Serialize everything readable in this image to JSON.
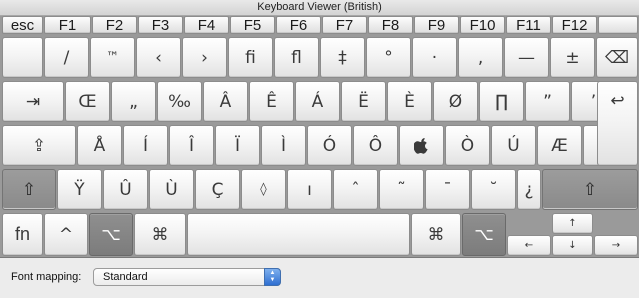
{
  "window": {
    "title": "Keyboard Viewer (British)"
  },
  "function_row": [
    "esc",
    "F1",
    "F2",
    "F3",
    "F4",
    "F5",
    "F6",
    "F7",
    "F8",
    "F9",
    "F10",
    "F11",
    "F12"
  ],
  "number_row": [
    "",
    "/",
    "™",
    "‹",
    "›",
    "fi",
    "fl",
    "‡",
    "°",
    "·",
    "‚",
    "—",
    "±",
    "⌫"
  ],
  "qwerty_row": [
    "⇥",
    "Œ",
    "„",
    "‰",
    "Â",
    "Ê",
    "Á",
    "Ë",
    "È",
    "Ø",
    "∏",
    "”",
    "’",
    "↩"
  ],
  "home_row": [
    "⇪",
    "Å",
    "Í",
    "Î",
    "Ï",
    "Ì",
    "Ó",
    "Ô",
    "",
    "Ò",
    "Ú",
    "Æ",
    "»"
  ],
  "shift_row": [
    "⇧",
    "Ÿ",
    "Û",
    "Ù",
    "Ç",
    "◊",
    "ı",
    "ˆ",
    "˜",
    "¯",
    "˘",
    "¿",
    "⇧"
  ],
  "bottom_row": {
    "fn": "fn",
    "control": "^",
    "option_left": "⌥",
    "command_left": "⌘",
    "space": "",
    "command_right": "⌘",
    "option_right": "⌥",
    "arrow_up": "↑",
    "arrow_left": "←",
    "arrow_down": "↓",
    "arrow_right": "→"
  },
  "footer": {
    "label": "Font mapping:",
    "select_value": "Standard",
    "select_arrow_up": "▲",
    "select_arrow_down": "▼"
  },
  "colors": {
    "pressed_modifier": "#8a8a8a",
    "keyboard_bg": "#9a9a9a",
    "select_accent": "#2f6fd1"
  }
}
